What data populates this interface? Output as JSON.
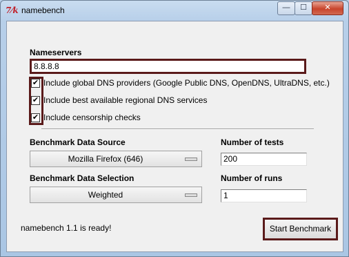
{
  "window": {
    "title": "namebench",
    "icon_glyph": "7⁄k",
    "controls": {
      "minimize": "—",
      "maximize": "☐",
      "close": "✕"
    }
  },
  "nameservers": {
    "label": "Nameservers",
    "value": "8.8.8.8"
  },
  "options": [
    {
      "label": "Include global DNS providers (Google Public DNS, OpenDNS, UltraDNS, etc.)",
      "checked": true
    },
    {
      "label": "Include best available regional DNS services",
      "checked": true
    },
    {
      "label": "Include censorship checks",
      "checked": true
    }
  ],
  "benchmark": {
    "data_source_label": "Benchmark Data Source",
    "data_source_value": "Mozilla Firefox (646)",
    "data_selection_label": "Benchmark Data Selection",
    "data_selection_value": "Weighted",
    "num_tests_label": "Number of tests",
    "num_tests_value": "200",
    "num_runs_label": "Number of runs",
    "num_runs_value": "1"
  },
  "status_text": "namebench 1.1 is ready!",
  "start_button_label": "Start Benchmark",
  "colors": {
    "highlight_border": "#5a1a1a",
    "title_bar": "#b9d1ea",
    "close_button": "#c8442c"
  }
}
